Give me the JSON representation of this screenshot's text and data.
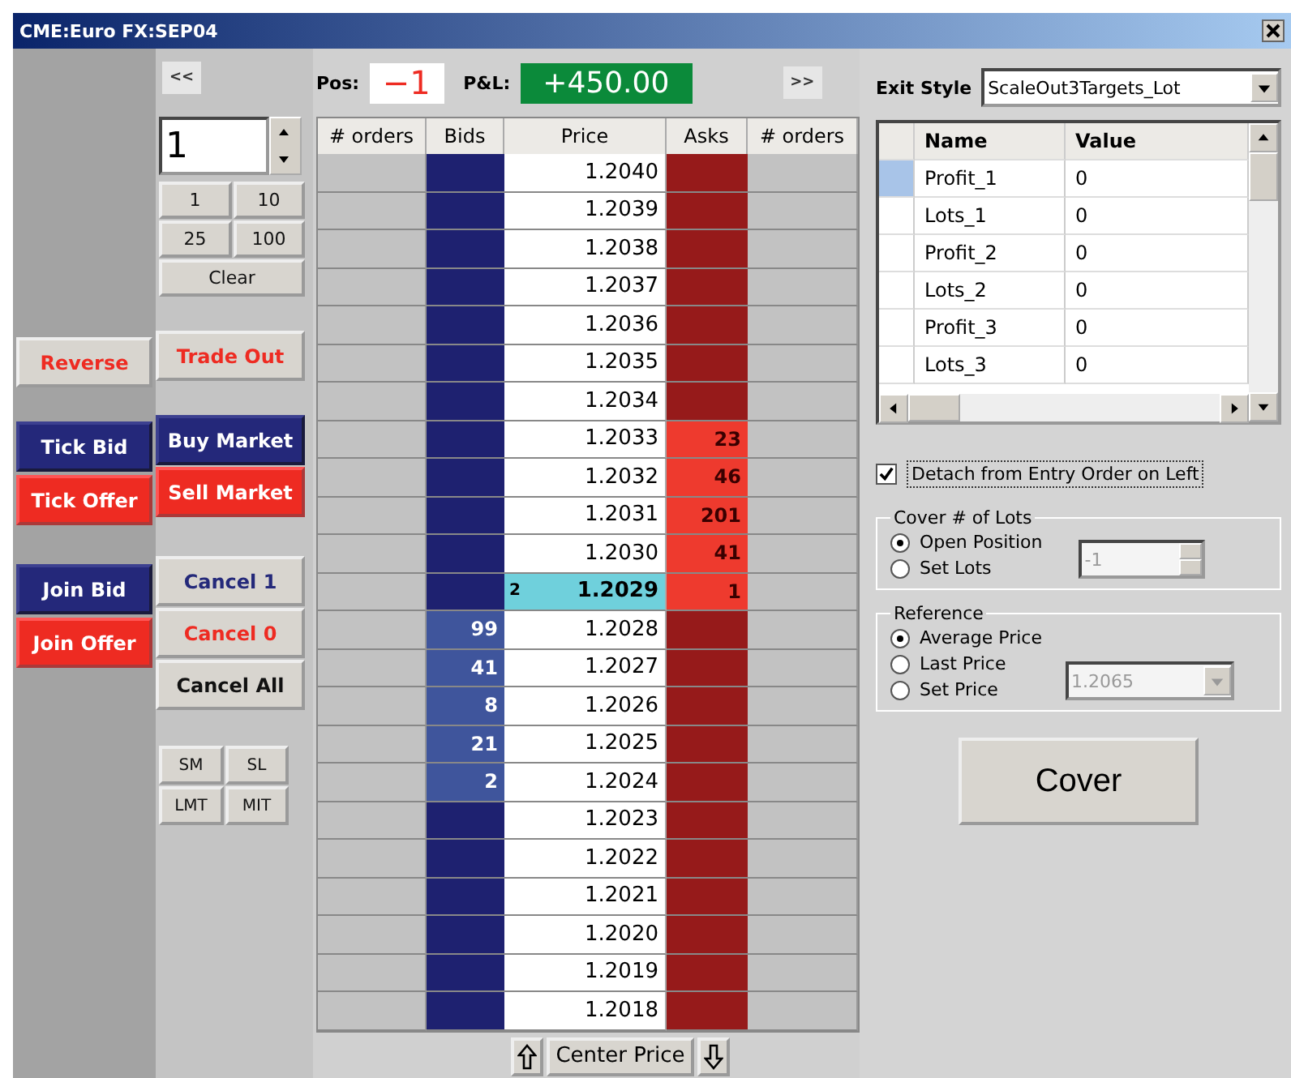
{
  "window": {
    "title": "CME:Euro FX:SEP04"
  },
  "collapse_button": "<<",
  "quantity": {
    "value": "1"
  },
  "quick_quantities": [
    "1",
    "10",
    "25",
    "100"
  ],
  "clear_button": "Clear",
  "strip_groups": [
    [
      {
        "label": "Reverse",
        "kind": "text-red"
      }
    ],
    [
      {
        "label": "Tick Bid",
        "kind": "bid"
      },
      {
        "label": "Tick Offer",
        "kind": "offer"
      }
    ],
    [
      {
        "label": "Join Bid",
        "kind": "bid"
      },
      {
        "label": "Join Offer",
        "kind": "offer"
      }
    ]
  ],
  "action_groups": [
    [
      {
        "label": "Trade Out",
        "kind": "text-red"
      }
    ],
    [
      {
        "label": "Buy Market",
        "kind": "bid"
      },
      {
        "label": "Sell Market",
        "kind": "offer"
      }
    ],
    [
      {
        "label": "Cancel 1",
        "kind": "text-blue"
      },
      {
        "label": "Cancel 0",
        "kind": "text-red"
      },
      {
        "label": "Cancel All",
        "kind": "text-dark"
      }
    ]
  ],
  "order_types": [
    "SM",
    "SL",
    "LMT",
    "MIT"
  ],
  "position": {
    "label": "Pos:",
    "value": "−1"
  },
  "pnl": {
    "label": "P&L:",
    "value": "+450.00"
  },
  "expand_button": ">>",
  "ladder": {
    "columns": [
      "# orders",
      "Bids",
      "Price",
      "Asks",
      "# orders"
    ],
    "rows": [
      {
        "price": "1.2040",
        "last": false
      },
      {
        "price": "1.2039",
        "last": false
      },
      {
        "price": "1.2038",
        "last": false
      },
      {
        "price": "1.2037",
        "last": false
      },
      {
        "price": "1.2036",
        "last": false
      },
      {
        "price": "1.2035",
        "last": false
      },
      {
        "price": "1.2034",
        "last": false
      },
      {
        "price": "1.2033",
        "ask": "23",
        "last": false
      },
      {
        "price": "1.2032",
        "ask": "46",
        "last": false
      },
      {
        "price": "1.2031",
        "ask": "201",
        "last": false
      },
      {
        "price": "1.2030",
        "ask": "41",
        "last": false
      },
      {
        "price": "1.2029",
        "ask": "1",
        "last": true,
        "last_qty": "2"
      },
      {
        "price": "1.2028",
        "bid": "99",
        "last": false
      },
      {
        "price": "1.2027",
        "bid": "41",
        "last": false
      },
      {
        "price": "1.2026",
        "bid": "8",
        "last": false
      },
      {
        "price": "1.2025",
        "bid": "21",
        "last": false
      },
      {
        "price": "1.2024",
        "bid": "2",
        "last": false
      },
      {
        "price": "1.2023",
        "last": false
      },
      {
        "price": "1.2022",
        "last": false
      },
      {
        "price": "1.2021",
        "last": false
      },
      {
        "price": "1.2020",
        "last": false
      },
      {
        "price": "1.2019",
        "last": false
      },
      {
        "price": "1.2018",
        "last": false
      }
    ],
    "center_button": "Center Price"
  },
  "exit_style": {
    "label": "Exit Style",
    "value": "ScaleOut3Targets_Lot"
  },
  "parameters": {
    "columns": [
      "Name",
      "Value"
    ],
    "rows": [
      {
        "name": "Profit_1",
        "value": "0",
        "selected": true
      },
      {
        "name": "Lots_1",
        "value": "0",
        "selected": false
      },
      {
        "name": "Profit_2",
        "value": "0",
        "selected": false
      },
      {
        "name": "Lots_2",
        "value": "0",
        "selected": false
      },
      {
        "name": "Profit_3",
        "value": "0",
        "selected": false
      },
      {
        "name": "Lots_3",
        "value": "0",
        "selected": false
      }
    ]
  },
  "detach": {
    "label": "Detach from Entry Order on Left",
    "checked": true
  },
  "cover_lots": {
    "title": "Cover # of Lots",
    "options": [
      {
        "label": "Open Position",
        "selected": true
      },
      {
        "label": "Set Lots",
        "selected": false
      }
    ],
    "lots_value": "-1"
  },
  "reference": {
    "title": "Reference",
    "options": [
      {
        "label": "Average Price",
        "selected": true
      },
      {
        "label": "Last Price",
        "selected": false
      },
      {
        "label": "Set Price",
        "selected": false
      }
    ],
    "price_value": "1.2065"
  },
  "cover_button": "Cover"
}
